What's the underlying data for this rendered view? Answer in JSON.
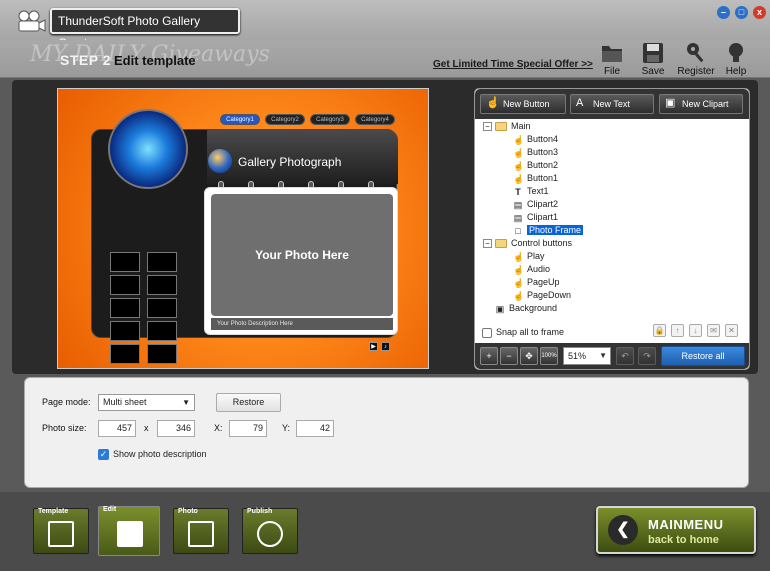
{
  "window": {
    "title": "ThunderSoft Photo Gallery Creator",
    "controls": [
      "min",
      "max",
      "close"
    ]
  },
  "header": {
    "step": "STEP 2",
    "title": "Edit template",
    "watermark": "MY DAILY Giveaways",
    "offer_link": "Get Limited Time Special Offer >>",
    "tools": [
      {
        "label": "File",
        "icon": "folder-icon"
      },
      {
        "label": "Save",
        "icon": "floppy-icon"
      },
      {
        "label": "Register",
        "icon": "key-icon"
      },
      {
        "label": "Help",
        "icon": "lightbulb-icon"
      }
    ]
  },
  "preview": {
    "categories": [
      "Category1",
      "Category2",
      "Category3",
      "Category4"
    ],
    "gallery_title": "Gallery Photograph",
    "photo_placeholder": "Your Photo Here",
    "photo_description": "Your Photo Description Here"
  },
  "objects": {
    "toolbar": [
      {
        "label": "New Button",
        "icon": "hand-icon"
      },
      {
        "label": "New Text",
        "icon": "text-icon"
      },
      {
        "label": "New Clipart",
        "icon": "image-icon"
      }
    ],
    "tree": {
      "main": {
        "label": "Main",
        "children": [
          "Button4",
          "Button3",
          "Button2",
          "Button1",
          "Text1",
          "Clipart2",
          "Clipart1",
          "Photo Frame"
        ]
      },
      "controls": {
        "label": "Control buttons",
        "children": [
          "Play",
          "Audio",
          "PageUp",
          "PageDown"
        ]
      },
      "background": "Background",
      "selected": "Photo Frame"
    },
    "snap_label": "Snap all to frame",
    "snap_checked": false,
    "zoom": "51%",
    "zoom_full_label": "100%",
    "restore_all": "Restore all"
  },
  "properties": {
    "page_mode_label": "Page mode:",
    "page_mode_value": "Multi sheet",
    "restore_label": "Restore",
    "photo_size_label": "Photo size:",
    "width": "457",
    "times": "x",
    "height": "346",
    "x_label": "X:",
    "x_value": "79",
    "y_label": "Y:",
    "y_value": "42",
    "show_desc_label": "Show photo description",
    "show_desc_checked": true
  },
  "nav": {
    "tabs": [
      {
        "label": "Template",
        "icon": "template-icon"
      },
      {
        "label": "Edit",
        "icon": "edit-icon"
      },
      {
        "label": "Photo",
        "icon": "photo-icon"
      },
      {
        "label": "Publish",
        "icon": "publish-icon"
      }
    ],
    "active": "Edit",
    "mainmenu_title": "MAINMENU",
    "mainmenu_sub": "back to home"
  },
  "colors": {
    "accent_blue": "#0a64d8",
    "nav_green": "#5a6c1c",
    "canvas_orange": "#ff8a1c"
  }
}
